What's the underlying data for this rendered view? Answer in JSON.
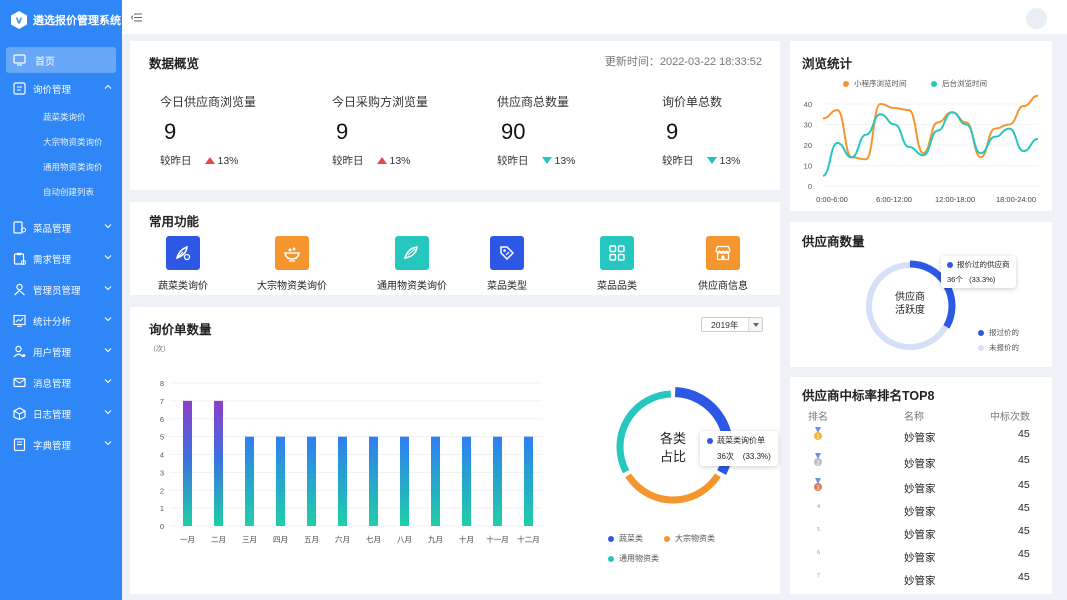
{
  "app": {
    "title": "遴选报价管理系统"
  },
  "colors": {
    "primary": "#2f86f6",
    "up": "#e34b4b",
    "down": "#25c4c4",
    "orange": "#f5952d",
    "blue": "#2d58e6",
    "teal": "#26c7be"
  },
  "sidebar": {
    "home": "首页",
    "items": [
      {
        "label": "询价管理",
        "icon": "message-icon",
        "expanded": true,
        "sub": [
          "蔬菜类询价",
          "大宗物资类询价",
          "通用物资类询价",
          "自动创建列表"
        ]
      },
      {
        "label": "菜品管理",
        "icon": "dish-icon"
      },
      {
        "label": "需求管理",
        "icon": "clipboard-icon"
      },
      {
        "label": "管理员管理",
        "icon": "admin-icon"
      },
      {
        "label": "统计分析",
        "icon": "chart-icon"
      },
      {
        "label": "用户管理",
        "icon": "user-icon"
      },
      {
        "label": "消息管理",
        "icon": "mail-icon"
      },
      {
        "label": "日志管理",
        "icon": "cube-icon"
      },
      {
        "label": "字典管理",
        "icon": "book-icon"
      }
    ]
  },
  "overview": {
    "title": "数据概览",
    "updated": "更新时间：2022-03-22 18:33:52",
    "stats": [
      {
        "label": "今日供应商浏览量",
        "value": "9",
        "cmp_label": "较昨日",
        "cmp": "13%",
        "trend": "up"
      },
      {
        "label": "今日采购方浏览量",
        "value": "9",
        "cmp_label": "较昨日",
        "cmp": "13%",
        "trend": "up"
      },
      {
        "label": "供应商总数量",
        "value": "90",
        "cmp_label": "较昨日",
        "cmp": "13%",
        "trend": "down"
      },
      {
        "label": "询价单总数",
        "value": "9",
        "cmp_label": "较昨日",
        "cmp": "13%",
        "trend": "down"
      }
    ]
  },
  "functions": {
    "title": "常用功能",
    "items": [
      {
        "label": "蔬菜类询价",
        "icon": "vegetable-icon",
        "color": "#2d58e6"
      },
      {
        "label": "大宗物资类询价",
        "icon": "bowl-icon",
        "color": "#f5952d"
      },
      {
        "label": "通用物资类询价",
        "icon": "fish-icon",
        "color": "#26c7be"
      },
      {
        "label": "菜品类型",
        "icon": "tag-icon",
        "color": "#2d58e6"
      },
      {
        "label": "菜品品类",
        "icon": "grid-icon",
        "color": "#26c7be"
      },
      {
        "label": "供应商信息",
        "icon": "store-icon",
        "color": "#f5952d"
      }
    ]
  },
  "inquiry": {
    "title": "询价单数量",
    "year": "2019年",
    "unit": "（次）",
    "donut_center": [
      "各类",
      "占比"
    ],
    "tooltip": {
      "name": "蔬菜类询价单",
      "value": "36次",
      "pct": "(33.3%)"
    },
    "legend": [
      "蔬菜类",
      "大宗物资类",
      "通用物资类"
    ]
  },
  "chart_data": [
    {
      "type": "bar",
      "categories": [
        "一月",
        "二月",
        "三月",
        "四月",
        "五月",
        "六月",
        "七月",
        "八月",
        "九月",
        "十月",
        "十一月",
        "十二月"
      ],
      "values": [
        7,
        7,
        5,
        5,
        5,
        5,
        5,
        5,
        5,
        5,
        5,
        5
      ],
      "ylabel": "（次）",
      "ylim": [
        0,
        8
      ],
      "yticks": [
        "0",
        "1",
        "2",
        "3",
        "4",
        "5",
        "6",
        "7",
        "8"
      ],
      "grid": true
    },
    {
      "type": "pie",
      "labels": [
        "蔬菜类",
        "大宗物资类",
        "通用物资类"
      ],
      "values": [
        33.3,
        33.3,
        33.3
      ],
      "colors": [
        "#2d58e6",
        "#f5952d",
        "#26c7be"
      ]
    },
    {
      "type": "line",
      "title": "浏览统计",
      "x_labels": [
        "0:00-6:00",
        "6:00-12:00",
        "12:00-18:00",
        "18:00-24:00"
      ],
      "yticks": [
        "0",
        "10",
        "20",
        "30",
        "40"
      ],
      "ylim": [
        0,
        40
      ],
      "series": [
        {
          "name": "小程序浏览时间",
          "color": "#f5952d",
          "values": [
            33,
            37,
            14,
            13,
            40,
            38,
            37,
            16,
            31,
            36,
            31,
            14,
            28,
            30,
            39,
            44
          ]
        },
        {
          "name": "后台浏览时间",
          "color": "#26c7be",
          "values": [
            5,
            21,
            14,
            25,
            35,
            30,
            19,
            15,
            27,
            36,
            30,
            16,
            24,
            28,
            17,
            23
          ]
        }
      ]
    },
    {
      "type": "pie",
      "title": "供应商数量",
      "labels": [
        "报过价的",
        "未报价的"
      ],
      "values": [
        33.3,
        66.7
      ],
      "colors": [
        "#2d58e6",
        "#d5dff7"
      ]
    }
  ],
  "browse": {
    "title": "浏览统计",
    "legend": [
      "小程序浏览时间",
      "后台浏览时间"
    ]
  },
  "supplier": {
    "title": "供应商数量",
    "center": [
      "供应商",
      "活跃度"
    ],
    "tooltip": {
      "name": "报价过的供应商",
      "value": "36个",
      "pct": "(33.3%)"
    },
    "legend": [
      "报过价的",
      "未报价的"
    ]
  },
  "ranking": {
    "title": "供应商中标率排名TOP8",
    "headers": [
      "排名",
      "名称",
      "中标次数"
    ],
    "rows": [
      {
        "rank": "1",
        "name": "妙管家",
        "count": "45",
        "medal": "gold"
      },
      {
        "rank": "2",
        "name": "妙管家",
        "count": "45",
        "medal": "silver"
      },
      {
        "rank": "3",
        "name": "妙管家",
        "count": "45",
        "medal": "bronze"
      },
      {
        "rank": "4",
        "name": "妙管家",
        "count": "45"
      },
      {
        "rank": "5",
        "name": "妙管家",
        "count": "45"
      },
      {
        "rank": "6",
        "name": "妙管家",
        "count": "45"
      },
      {
        "rank": "7",
        "name": "妙管家",
        "count": "45"
      }
    ]
  }
}
